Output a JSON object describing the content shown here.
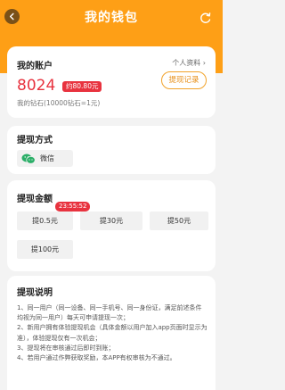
{
  "header": {
    "title": "我的钱包",
    "back_icon": "back-arrow-icon",
    "refresh_icon": "refresh-icon",
    "color": "#fe9f16"
  },
  "account": {
    "title": "我的账户",
    "profile_link": "个人资料 ›",
    "balance": "8024",
    "yuan_badge": "约80.80元",
    "rate": "我的钻石(10000钻石=1元)",
    "record_button": "提现记录"
  },
  "method": {
    "title": "提现方式",
    "option_icon": "wechat-icon",
    "option_label": "微信"
  },
  "amount": {
    "title": "提现金额",
    "timer": "23:55:52",
    "options": [
      "提0.5元",
      "提30元",
      "提50元",
      "提100元"
    ]
  },
  "notes": {
    "title": "提现说明",
    "lines": [
      "1、同一用户（同一设备、同一手机号、同一身份证，满足前述条件均视为同一用户）每天可申请提现一次；",
      "2、新用户拥有体验提现机会（具体金额以用户加入app页面时显示为准），体验提现仅有一次机会；",
      "3、提现将在审核通过后即时到账；",
      "4、若用户通过作弊获取奖励，本APP有权审核为不通过。"
    ]
  },
  "colors": {
    "accent_red": "#e8333f",
    "record_orange": "#e89320",
    "wechat_green": "#2aae67"
  }
}
